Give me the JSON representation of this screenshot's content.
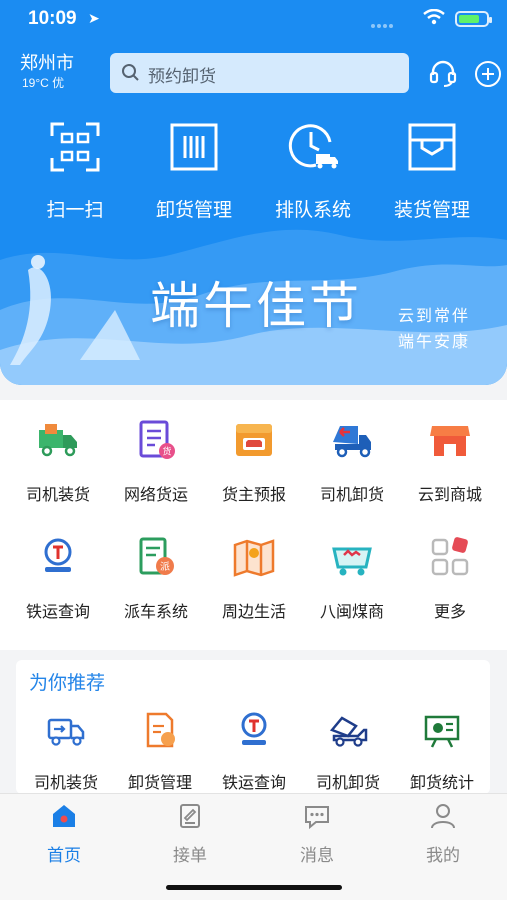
{
  "status": {
    "time": "10:09",
    "battery_color": "#5ff26a"
  },
  "header": {
    "city": "郑州市",
    "weather": "19°C 优",
    "search_placeholder": "预约卸货",
    "icons": [
      "headset-icon",
      "plus-circle-icon",
      "search-icon"
    ]
  },
  "quick_actions": [
    {
      "label": "扫一扫",
      "icon": "scan-icon"
    },
    {
      "label": "卸货管理",
      "icon": "unload-manage-icon"
    },
    {
      "label": "排队系统",
      "icon": "queue-clock-truck-icon"
    },
    {
      "label": "装货管理",
      "icon": "load-manage-icon"
    }
  ],
  "banner": {
    "title": "端午佳节",
    "line1": "云到常伴",
    "line2": "端午安康"
  },
  "services": [
    {
      "label": "司机装货",
      "icon": "driver-load-truck-icon"
    },
    {
      "label": "网络货运",
      "icon": "network-freight-icon"
    },
    {
      "label": "货主预报",
      "icon": "shipper-forecast-icon"
    },
    {
      "label": "司机卸货",
      "icon": "driver-unload-truck-icon"
    },
    {
      "label": "云到商城",
      "icon": "shop-icon"
    },
    {
      "label": "铁运查询",
      "icon": "rail-query-icon"
    },
    {
      "label": "派车系统",
      "icon": "dispatch-icon"
    },
    {
      "label": "周边生活",
      "icon": "nearby-life-icon"
    },
    {
      "label": "八闽煤商",
      "icon": "coal-cart-icon"
    },
    {
      "label": "更多",
      "icon": "more-grid-icon"
    }
  ],
  "recommend": {
    "title": "为你推荐",
    "items": [
      {
        "label": "司机装货",
        "icon": "truck-outline-icon"
      },
      {
        "label": "卸货管理",
        "icon": "doc-manage-icon"
      },
      {
        "label": "铁运查询",
        "icon": "rail-query-icon"
      },
      {
        "label": "司机卸货",
        "icon": "dump-truck-icon"
      },
      {
        "label": "卸货统计",
        "icon": "stats-board-icon"
      }
    ]
  },
  "tabbar": [
    {
      "label": "首页",
      "icon": "home-icon",
      "active": true
    },
    {
      "label": "接单",
      "icon": "order-icon",
      "active": false
    },
    {
      "label": "消息",
      "icon": "message-icon",
      "active": false
    },
    {
      "label": "我的",
      "icon": "profile-icon",
      "active": false
    }
  ],
  "colors": {
    "primary": "#1b8cf2",
    "tab_active": "#1b7fe6",
    "recommend_title": "#2485e8"
  }
}
